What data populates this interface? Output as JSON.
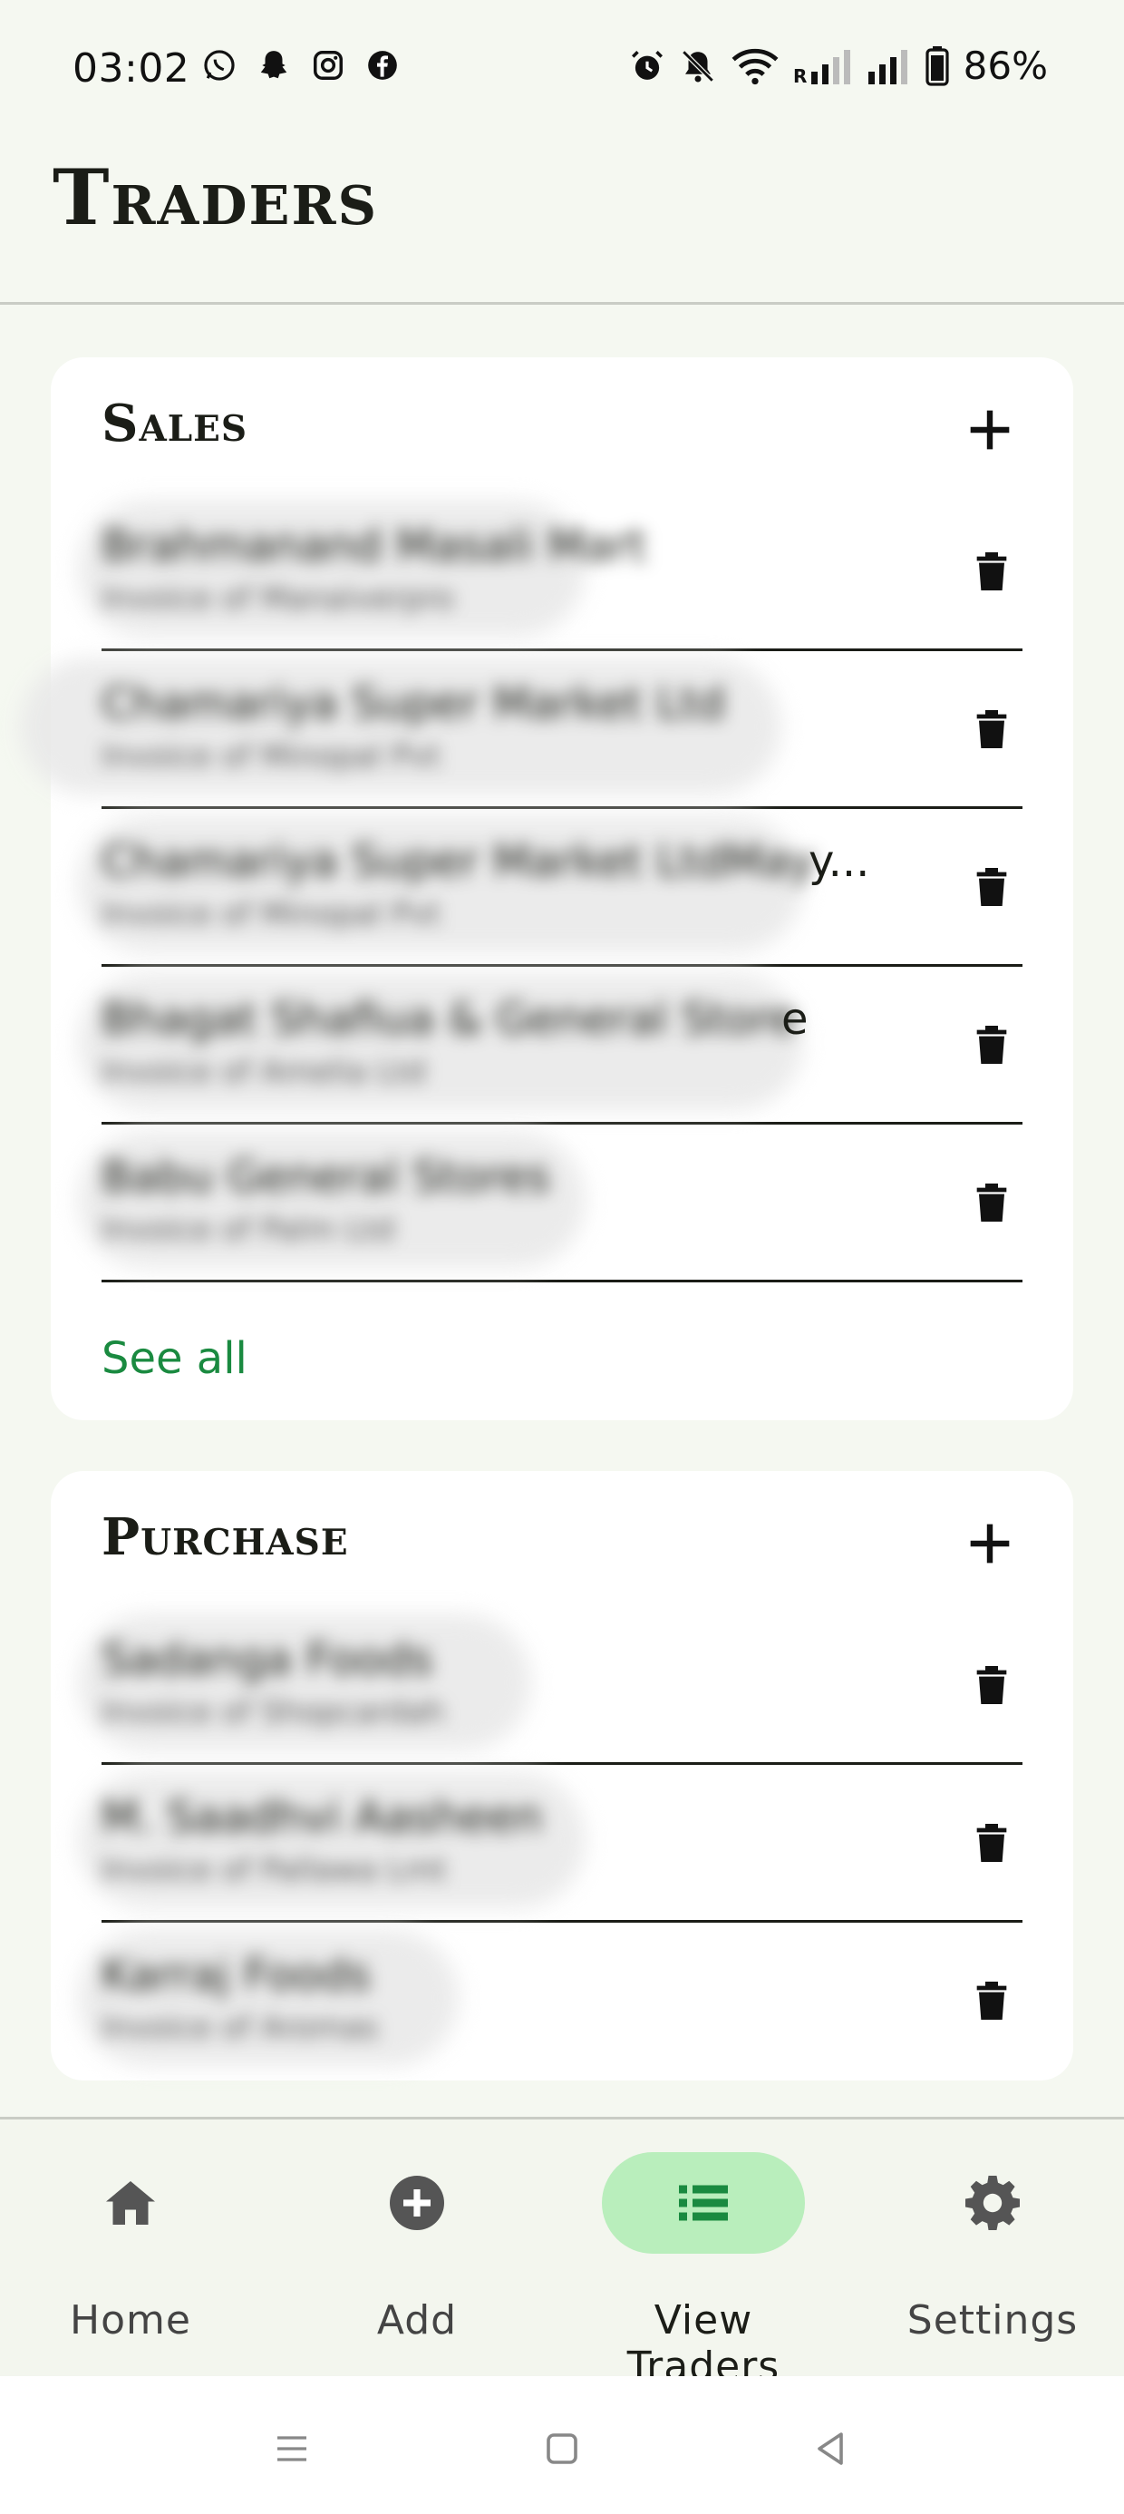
{
  "status_bar": {
    "time": "03:02",
    "battery": "86%",
    "left_icons": [
      "whatsapp-icon",
      "snapchat-icon",
      "instagram-icon",
      "facebook-icon"
    ],
    "right_icons": [
      "alarm-icon",
      "bell-muted-icon",
      "wifi-icon",
      "signal-icon",
      "signal-icon",
      "battery-icon"
    ]
  },
  "header": {
    "title": "Traders"
  },
  "sales": {
    "title": "Sales",
    "items": [
      {
        "name": "Brahmanand Masali Mart",
        "sub": "Invoice of Manaiverpro",
        "tail": ""
      },
      {
        "name": "Chamariya Super Market Ltd",
        "sub": "Invoice of Minopal Pvt",
        "tail": ""
      },
      {
        "name": "Chamariya Super Market LtdMay",
        "sub": "Invoice of Minopal Pvt",
        "tail": "y..."
      },
      {
        "name": "Bhagat Shafiua & General Store",
        "sub": "Invoice of Amelia Ltd",
        "tail": "e"
      },
      {
        "name": "Babu General Stores",
        "sub": "Invoice of Palm Ltd",
        "tail": ""
      }
    ],
    "see_all": "See all"
  },
  "purchase": {
    "title": "Purchase",
    "items": [
      {
        "name": "Sadanga Foods",
        "sub": "Invoice of Shopcardah",
        "tail": ""
      },
      {
        "name": "M. Saadhvi Aasheen",
        "sub": "Invoice of Pallawa Lmt",
        "tail": ""
      },
      {
        "name": "Karraj Foods",
        "sub": "Invoice of Aromas",
        "tail": ""
      }
    ]
  },
  "nav": {
    "items": [
      {
        "label": "Home",
        "icon": "home-icon",
        "active": false
      },
      {
        "label": "Add",
        "icon": "add-circle-icon",
        "active": false
      },
      {
        "label": "View Traders",
        "icon": "list-icon",
        "active": true
      },
      {
        "label": "Settings",
        "icon": "gear-icon",
        "active": false
      }
    ]
  },
  "colors": {
    "accent": "#1a8a40",
    "active_pill": "#b9eebc",
    "background": "#f5f8f1",
    "card": "#ffffff"
  }
}
